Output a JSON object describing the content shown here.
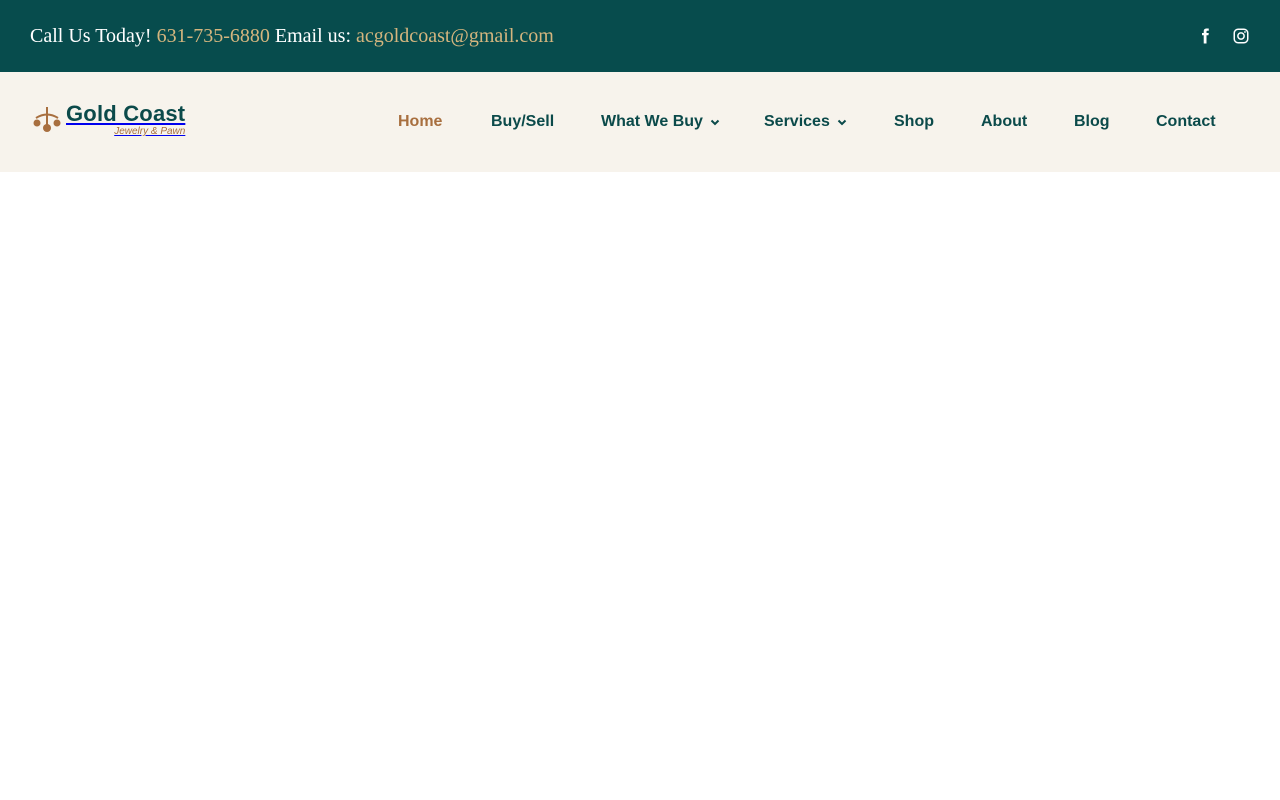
{
  "topbar": {
    "call_label": "Call Us Today!",
    "phone": "631-735-6880",
    "email_label": "Email us:",
    "email": "acgoldcoast@gmail.com",
    "social_icons": [
      "facebook-icon",
      "instagram-icon"
    ]
  },
  "logo": {
    "title": "Gold Coast",
    "subtitle": "Jewelry & Pawn"
  },
  "nav": {
    "items": [
      {
        "label": "Home",
        "active": true
      },
      {
        "label": "Buy/Sell"
      },
      {
        "label": "What We Buy",
        "dropdown": true
      },
      {
        "label": "Services",
        "dropdown": true
      },
      {
        "label": "Shop"
      },
      {
        "label": "About"
      },
      {
        "label": "Blog"
      },
      {
        "label": "Contact"
      }
    ]
  },
  "colors": {
    "topbar_bg": "#074c4d",
    "link_gold": "#d4b57e",
    "nav_bg": "#f7f3ec",
    "nav_text": "#0b4a4a",
    "nav_active": "#a86f3f"
  }
}
